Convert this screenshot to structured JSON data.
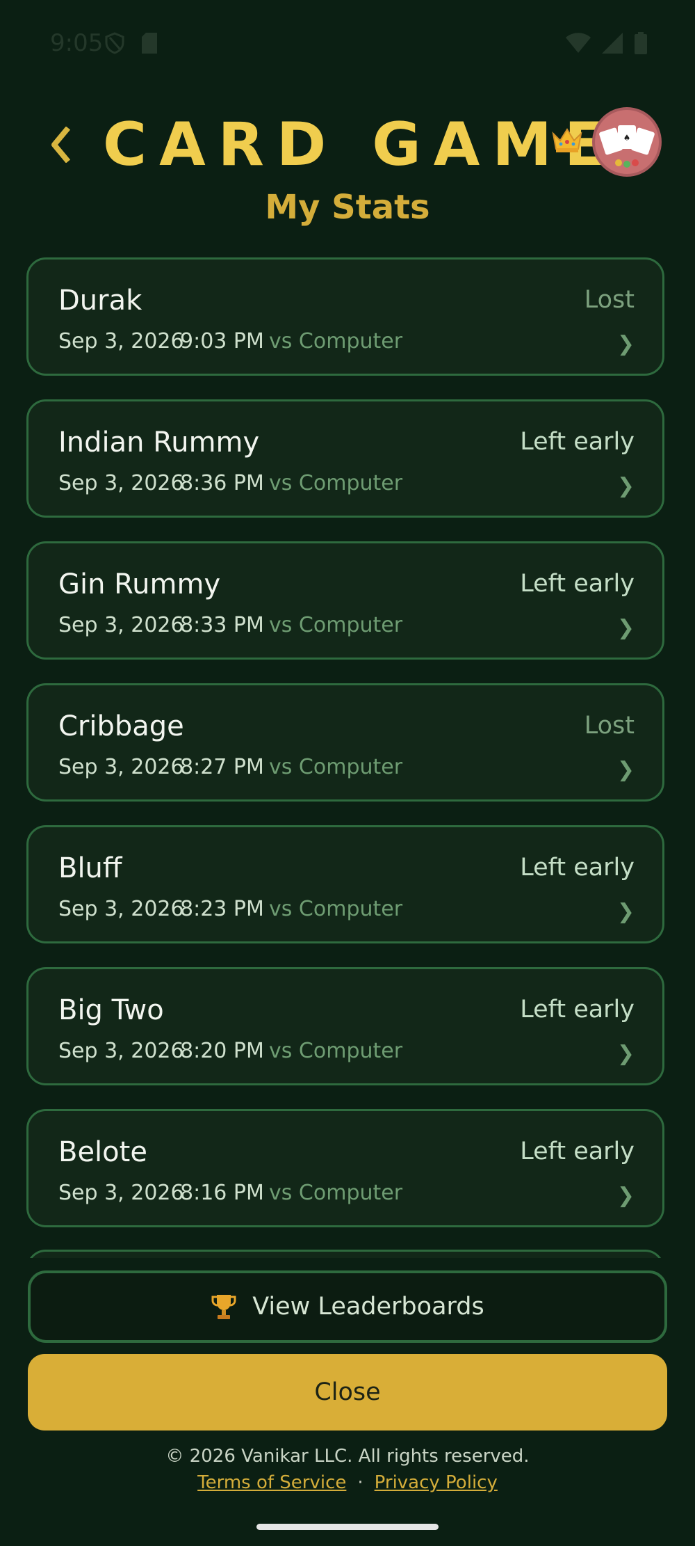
{
  "status_bar": {
    "time": "9:05"
  },
  "header": {
    "back_icon": "chevron-left-icon",
    "title": "CARD GAMES",
    "crown_icon": "crown-icon",
    "avatar_icon": "playing-cards-avatar",
    "subtitle": "My Stats"
  },
  "games": [
    {
      "name": "Durak",
      "status": "Lost",
      "date": "Sep 3, 2026",
      "time": "9:03 PM",
      "opponent": "vs Computer"
    },
    {
      "name": "Indian Rummy",
      "status": "Left early",
      "date": "Sep 3, 2026",
      "time": "8:36 PM",
      "opponent": "vs Computer"
    },
    {
      "name": "Gin Rummy",
      "status": "Left early",
      "date": "Sep 3, 2026",
      "time": "8:33 PM",
      "opponent": "vs Computer"
    },
    {
      "name": "Cribbage",
      "status": "Lost",
      "date": "Sep 3, 2026",
      "time": "8:27 PM",
      "opponent": "vs Computer"
    },
    {
      "name": "Bluff",
      "status": "Left early",
      "date": "Sep 3, 2026",
      "time": "8:23 PM",
      "opponent": "vs Computer"
    },
    {
      "name": "Big Two",
      "status": "Left early",
      "date": "Sep 3, 2026",
      "time": "8:20 PM",
      "opponent": "vs Computer"
    },
    {
      "name": "Belote",
      "status": "Left early",
      "date": "Sep 3, 2026",
      "time": "8:16 PM",
      "opponent": "vs Computer"
    }
  ],
  "chevron_right": "❯",
  "leaderboard_button": {
    "icon": "trophy-icon",
    "label": "View Leaderboards"
  },
  "close_button": {
    "label": "Close"
  },
  "footer": {
    "copyright": "© 2026 Vanikar LLC. All rights reserved.",
    "terms": "Terms of Service",
    "separator": "·",
    "privacy": "Privacy Policy"
  },
  "colors": {
    "background": "#0b1f13",
    "accent_gold": "#f0cd4e",
    "card_border": "#2e6a3e",
    "button_gold": "#d9ae37"
  }
}
